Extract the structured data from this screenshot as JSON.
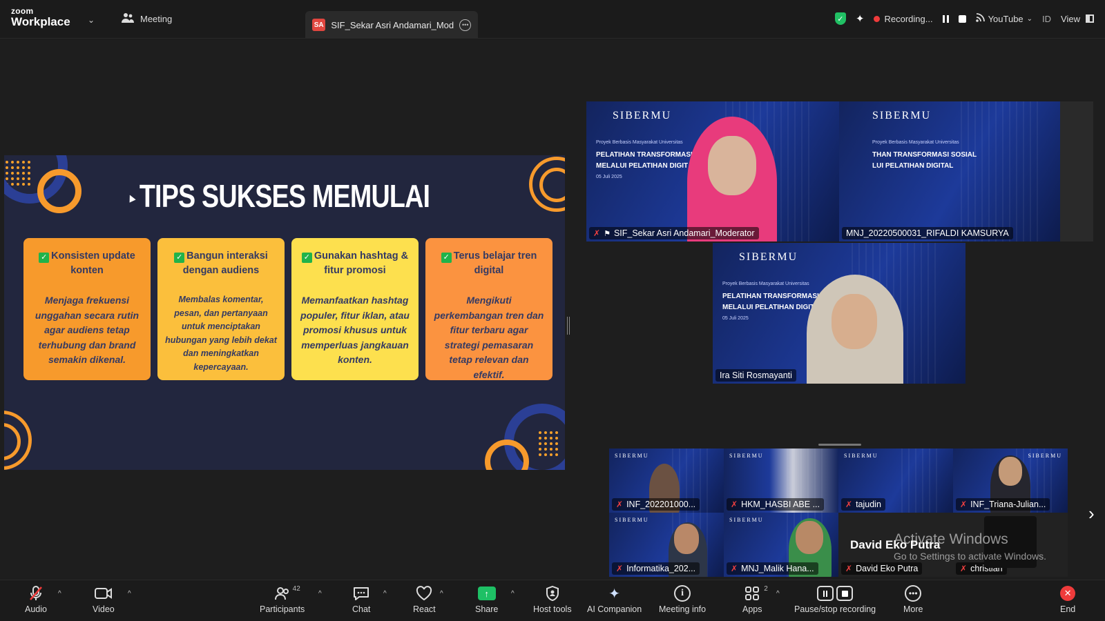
{
  "app": {
    "brand_small": "zoom",
    "brand_large": "Workplace"
  },
  "topbar": {
    "meeting_label": "Meeting",
    "tab_badge": "SA",
    "tab_title": "SIF_Sekar Asri Andamari_Moderat",
    "recording_label": "Recording...",
    "youtube_label": "YouTube",
    "lang_label": "ID",
    "view_label": "View"
  },
  "slide": {
    "title": "TIPS SUKSES MEMULAI",
    "cards": [
      {
        "heading": "Konsisten update konten",
        "body": "Menjaga frekuensi unggahan secara rutin agar audiens tetap terhubung dan brand semakin dikenal."
      },
      {
        "heading": "Bangun interaksi dengan audiens",
        "body": "Membalas komentar, pesan, dan pertanyaan untuk menciptakan hubungan yang lebih dekat dan meningkatkan kepercayaan."
      },
      {
        "heading": "Gunakan hashtag & fitur promosi",
        "body": "Memanfaatkan hashtag populer, fitur iklan, atau promosi khusus untuk memperluas jangkauan konten."
      },
      {
        "heading": "Terus belajar tren digital",
        "body": "Mengikuti perkembangan tren dan fitur terbaru agar strategi pemasaran tetap relevan dan efektif."
      }
    ]
  },
  "backdrop": {
    "logo": "SIBERMU",
    "subtitle": "Proyek Berbasis Masyarakat Universitas",
    "heading1": "PELATIHAN TRANSFORMASI",
    "heading2": "MELALUI PELATIHAN DIGIT",
    "heading1_alt": "THAN TRANSFORMASI SOSIAL",
    "heading2_alt": "LUI PELATIHAN DIGITAL",
    "date": "05 Juli 2025"
  },
  "participants_main": [
    {
      "name": "SIF_Sekar Asri Andamari_Moderator"
    },
    {
      "name": "MNJ_20220500031_RIFALDI KAMSURYA"
    },
    {
      "name": "Ira Siti Rosmayanti"
    }
  ],
  "participants_strip": [
    {
      "name": "INF_202201000..."
    },
    {
      "name": "HKM_HASBI ABE ..."
    },
    {
      "name": "tajudin"
    },
    {
      "name": "INF_Triana-Julian..."
    },
    {
      "name": "Informatika_202..."
    },
    {
      "name": "MNJ_Malik Hana..."
    },
    {
      "name": "David Eko Putra"
    },
    {
      "name": "christian"
    }
  ],
  "speaker_big_name": "David Eko Putra",
  "watermark": {
    "line1": "Activate Windows",
    "line2": "Go to Settings to activate Windows."
  },
  "toolbar": {
    "audio": "Audio",
    "video": "Video",
    "participants": "Participants",
    "participants_count": "42",
    "chat": "Chat",
    "react": "React",
    "share": "Share",
    "host_tools": "Host tools",
    "ai_companion": "AI Companion",
    "meeting_info": "Meeting info",
    "apps": "Apps",
    "apps_count": "2",
    "pause_stop": "Pause/stop recording",
    "more": "More",
    "end": "End"
  },
  "colors": {
    "accent_green": "#28e08b",
    "record_red": "#ef3b3b",
    "share_green": "#1ec065",
    "slide_bg": "#22263e"
  }
}
